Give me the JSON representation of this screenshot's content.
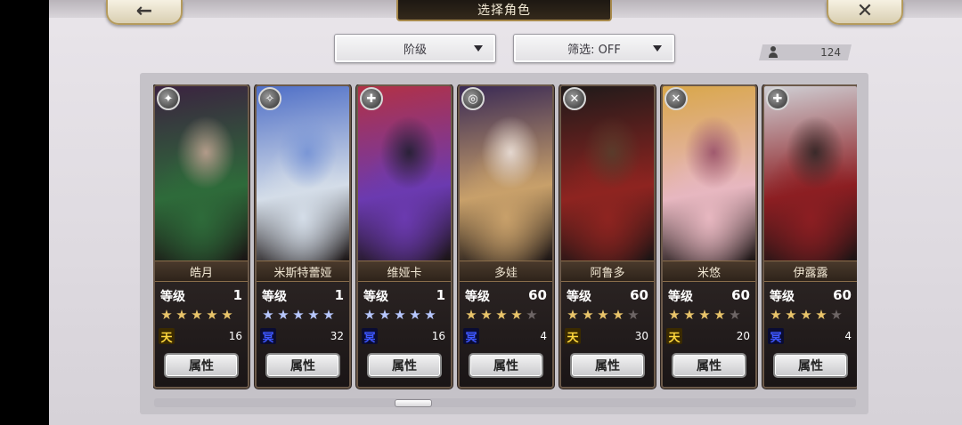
{
  "header": {
    "title": "选择角色",
    "back_icon": "←",
    "close_icon": "✕"
  },
  "filters": {
    "rank_label": "阶级",
    "filter_label": "筛选: OFF"
  },
  "roster_count": "124",
  "common": {
    "level_label": "等级",
    "attr_label": "属性"
  },
  "cards": [
    {
      "name": "皓月",
      "level": "1",
      "stars": 5,
      "stars_filled": 5,
      "star_color": "gold",
      "rank": "天",
      "rank_type": "tian",
      "count": "16",
      "class_icon": "✦",
      "colors": [
        "#3b2340",
        "#2e6b3a",
        "#b39b8a"
      ]
    },
    {
      "name": "米斯特蕾娅",
      "level": "1",
      "stars": 5,
      "stars_filled": 5,
      "star_color": "blue",
      "rank": "冥",
      "rank_type": "ming",
      "count": "32",
      "class_icon": "✧",
      "colors": [
        "#4f6fc7",
        "#d4dde8",
        "#7a96d6"
      ]
    },
    {
      "name": "维娅卡",
      "level": "1",
      "stars": 5,
      "stars_filled": 5,
      "star_color": "blue",
      "rank": "冥",
      "rank_type": "ming",
      "count": "16",
      "class_icon": "✚",
      "colors": [
        "#b23145",
        "#6b3ab0",
        "#2a2138"
      ]
    },
    {
      "name": "多娃",
      "level": "60",
      "stars": 5,
      "stars_filled": 4,
      "star_color": "gold",
      "rank": "冥",
      "rank_type": "ming",
      "count": "4",
      "class_icon": "◎",
      "colors": [
        "#3a2a55",
        "#c8a06a",
        "#e4d7cf"
      ]
    },
    {
      "name": "阿鲁多",
      "level": "60",
      "stars": 5,
      "stars_filled": 4,
      "star_color": "gold",
      "rank": "天",
      "rank_type": "tian",
      "count": "30",
      "class_icon": "✕",
      "colors": [
        "#1f1a1a",
        "#8e2420",
        "#5a3b2b"
      ]
    },
    {
      "name": "米悠",
      "level": "60",
      "stars": 5,
      "stars_filled": 4,
      "star_color": "gold",
      "rank": "天",
      "rank_type": "tian",
      "count": "20",
      "class_icon": "✕",
      "colors": [
        "#d9a74a",
        "#e7b7c0",
        "#a05a6e"
      ]
    },
    {
      "name": "伊露露",
      "level": "60",
      "stars": 5,
      "stars_filled": 4,
      "star_color": "gold",
      "rank": "冥",
      "rank_type": "ming",
      "count": "4",
      "class_icon": "✚",
      "colors": [
        "#cfcfd4",
        "#8c1e22",
        "#3a2a2a"
      ]
    }
  ]
}
